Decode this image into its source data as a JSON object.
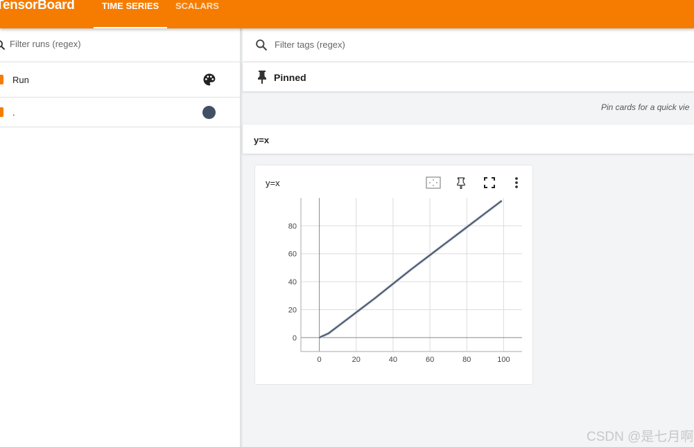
{
  "app": {
    "brand": "TensorBoard",
    "tabs": [
      {
        "label": "TIME SERIES",
        "active": true
      },
      {
        "label": "SCALARS",
        "active": false
      }
    ],
    "accent": "#f57c00"
  },
  "runs_panel": {
    "filter_placeholder": "Filter runs (regex)",
    "header_label": "Run",
    "runs": [
      {
        "name": ".",
        "color": "#425066",
        "checked": true
      }
    ]
  },
  "main": {
    "filter_tags_placeholder": "Filter tags (regex)",
    "pinned_title": "Pinned",
    "pinned_hint": "Pin cards for a quick vie",
    "group_title": "y=x",
    "card": {
      "title": "y=x",
      "toolbar_icons": [
        "fit-domain-icon",
        "pin-icon",
        "fullscreen-icon",
        "more-vert-icon"
      ]
    }
  },
  "chart_data": {
    "type": "line",
    "title": "y=x",
    "xlabel": "",
    "ylabel": "",
    "xlim": [
      -10,
      110
    ],
    "ylim": [
      -10,
      100
    ],
    "xticks": [
      0,
      20,
      40,
      60,
      80,
      100
    ],
    "yticks": [
      0,
      20,
      40,
      60,
      80
    ],
    "grid": true,
    "series": [
      {
        "color": "#425066",
        "x": [
          0,
          5,
          10,
          20,
          30,
          40,
          50,
          60,
          70,
          80,
          90,
          99
        ],
        "y": [
          0,
          3,
          8,
          18,
          28,
          38.5,
          49,
          59,
          69,
          79,
          89,
          98
        ]
      }
    ]
  },
  "watermark": "CSDN @是七月啊"
}
